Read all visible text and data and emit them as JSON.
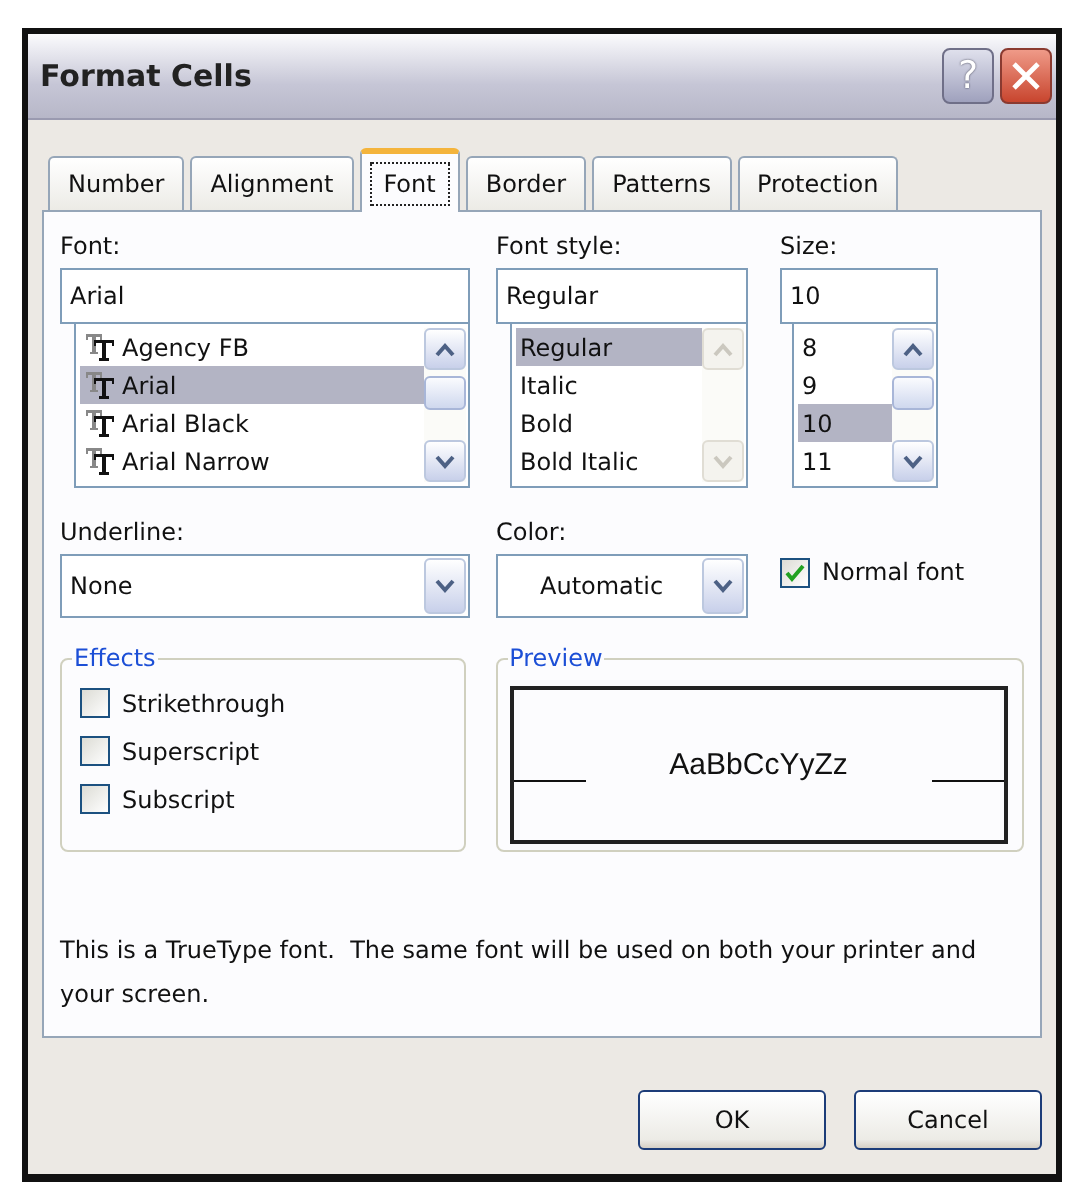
{
  "window": {
    "title": "Format Cells",
    "help": "?"
  },
  "tabs": [
    {
      "label": "Number",
      "selected": false
    },
    {
      "label": "Alignment",
      "selected": false
    },
    {
      "label": "Font",
      "selected": true
    },
    {
      "label": "Border",
      "selected": false
    },
    {
      "label": "Patterns",
      "selected": false
    },
    {
      "label": "Protection",
      "selected": false
    }
  ],
  "font": {
    "label": "Font:",
    "value": "Arial",
    "scrollbar_disabled": false,
    "items": [
      {
        "name": "Agency FB",
        "selected": false
      },
      {
        "name": "Arial",
        "selected": true
      },
      {
        "name": "Arial Black",
        "selected": false
      },
      {
        "name": "Arial Narrow",
        "selected": false
      }
    ]
  },
  "font_style": {
    "label": "Font style:",
    "value": "Regular",
    "scrollbar_disabled": true,
    "items": [
      {
        "name": "Regular",
        "selected": true
      },
      {
        "name": "Italic",
        "selected": false
      },
      {
        "name": "Bold",
        "selected": false
      },
      {
        "name": "Bold Italic",
        "selected": false
      }
    ]
  },
  "size": {
    "label": "Size:",
    "value": "10",
    "scrollbar_disabled": false,
    "items": [
      {
        "name": "8",
        "selected": false
      },
      {
        "name": "9",
        "selected": false
      },
      {
        "name": "10",
        "selected": true
      },
      {
        "name": "11",
        "selected": false
      }
    ]
  },
  "underline": {
    "label": "Underline:",
    "value": "None"
  },
  "color": {
    "label": "Color:",
    "value": "Automatic"
  },
  "normal_font": {
    "label": "Normal font",
    "checked": true
  },
  "effects": {
    "title": "Effects",
    "options": [
      {
        "label": "Strikethrough",
        "checked": false
      },
      {
        "label": "Superscript",
        "checked": false
      },
      {
        "label": "Subscript",
        "checked": false
      }
    ]
  },
  "preview": {
    "title": "Preview",
    "sample": "AaBbCcYyZz"
  },
  "info": "This is a TrueType font.  The same font will be used on both your printer and your screen.",
  "buttons": [
    {
      "label": "OK"
    },
    {
      "label": "Cancel"
    }
  ]
}
